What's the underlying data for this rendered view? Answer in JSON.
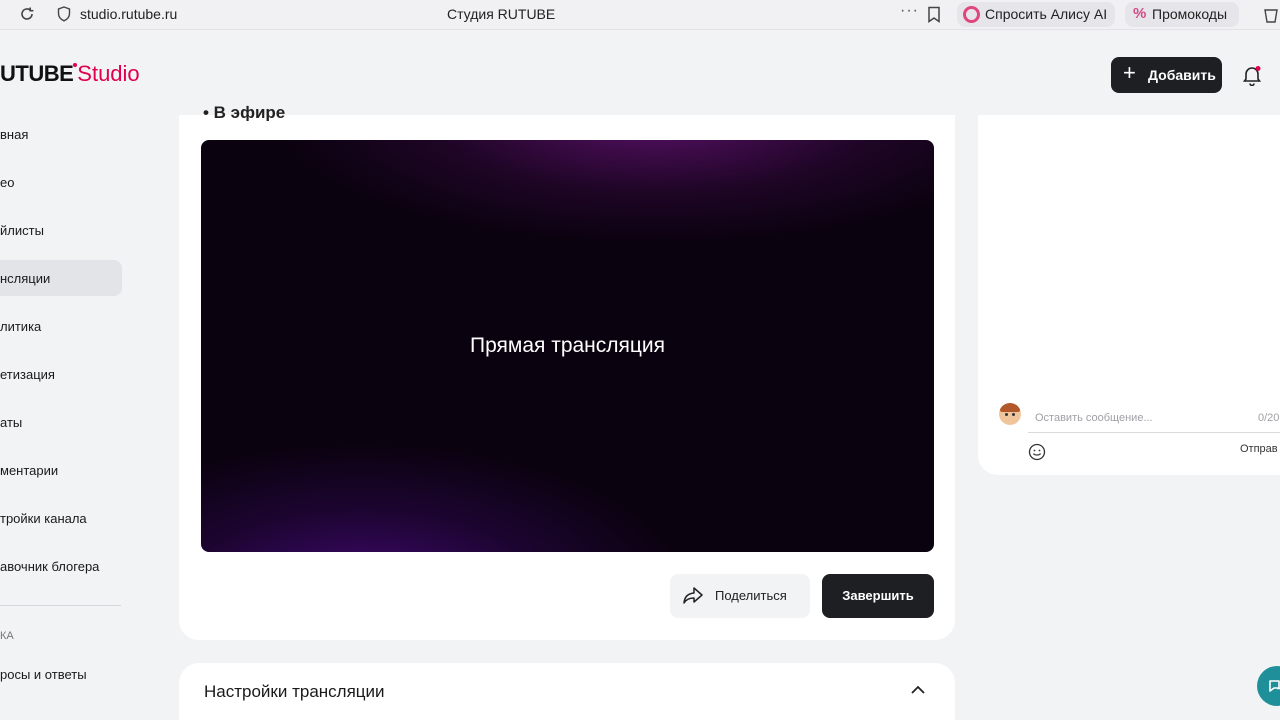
{
  "browser": {
    "url": "studio.rutube.ru",
    "tab_title": "Студия RUTUBE",
    "menu_dots": "···",
    "alice_label": "Спросить Алису AI",
    "promo_icon": "%",
    "promo_label": "Промокоды"
  },
  "header": {
    "logo_main": "UTUBE",
    "logo_accent": "Studio",
    "add_label": "Добавить",
    "add_icon": "+"
  },
  "sidebar": {
    "items": [
      {
        "label": "вная"
      },
      {
        "label": "ео"
      },
      {
        "label": "йлисты"
      },
      {
        "label": "нсляции",
        "active": true
      },
      {
        "label": "литика"
      },
      {
        "label": "етизация"
      },
      {
        "label": "аты"
      },
      {
        "label": "ментарии"
      },
      {
        "label": "тройки канала"
      },
      {
        "label": "авочник блогера"
      }
    ],
    "section_label": "КА",
    "section_items": [
      {
        "label": "росы и ответы"
      }
    ]
  },
  "live": {
    "header_partial": "• В эфире",
    "player_text": "Прямая трансляция",
    "share_label": "Поделиться",
    "end_label": "Завершить"
  },
  "settings": {
    "title": "Настройки трансляции"
  },
  "chat": {
    "placeholder": "Оставить сообщение...",
    "counter": "0/20",
    "send_label": "Отправ"
  },
  "colors": {
    "brand_accent": "#e0004d",
    "dark_button": "#1d1f22",
    "help_button": "#1f8f9a"
  },
  "icons": [
    "reload-icon",
    "shield-icon",
    "bookmark-icon",
    "alice-icon",
    "percent-icon",
    "extension-icon",
    "plus-icon",
    "bell-icon",
    "share-icon",
    "chevron-up-icon",
    "smile-icon",
    "support-icon"
  ]
}
